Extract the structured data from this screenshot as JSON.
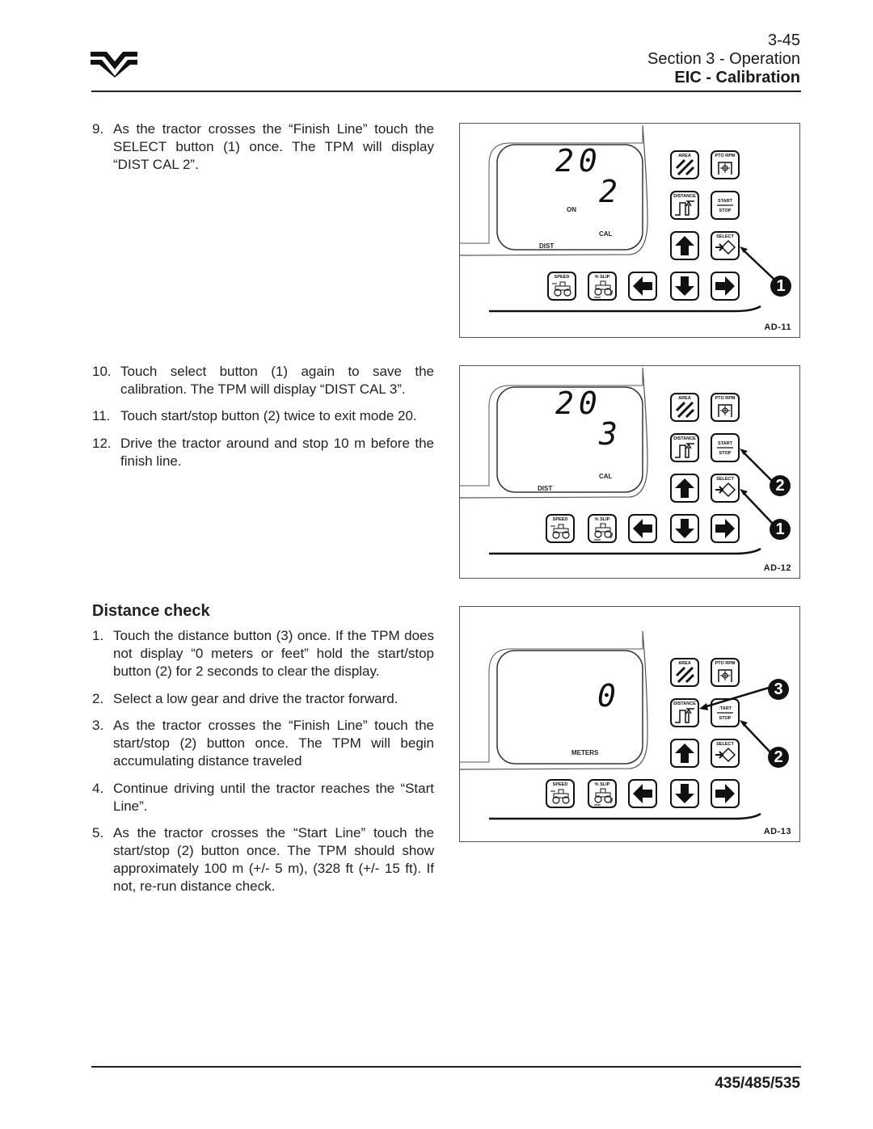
{
  "header": {
    "page_number": "3-45",
    "section": "Section 3 - Operation",
    "title": "EIC - Calibration"
  },
  "footer": {
    "model": "435/485/535"
  },
  "steps_top": [
    {
      "num": "9.",
      "text": "As the tractor crosses the “Finish Line” touch the SELECT button (1) once. The TPM will display “DIST CAL 2”."
    },
    {
      "num": "10.",
      "text": "Touch select button (1) again to save the calibration. The TPM will display “DIST CAL 3”."
    },
    {
      "num": "11.",
      "text": "Touch start/stop button (2) twice to exit mode 20."
    },
    {
      "num": "12.",
      "text": "Drive the tractor around and stop 10 m before the finish line."
    }
  ],
  "distance_check": {
    "heading": "Distance check",
    "steps": [
      {
        "num": "1.",
        "text": "Touch the distance button (3) once. If the TPM does not display “0 meters or feet” hold the start/stop button (2) for 2 seconds to clear the display."
      },
      {
        "num": "2.",
        "text": "Select a low gear and drive the tractor forward."
      },
      {
        "num": "3.",
        "text": "As the tractor crosses the “Finish Line” touch the start/stop (2) button once. The TPM will begin accumulating distance traveled"
      },
      {
        "num": "4.",
        "text": "Continue driving until the tractor reaches the “Start Line”."
      },
      {
        "num": "5.",
        "text": "As the tractor crosses the “Start Line” touch the start/stop (2) button once. The TPM should show approximately 100 m (+/- 5 m), (328 ft (+/- 15 ft). If not, re-run distance check."
      }
    ]
  },
  "keys": {
    "area": "AREA",
    "pto_rpm": "PTO RPM",
    "distance": "DISTANCE",
    "start": "START",
    "start_cut": ":TART",
    "stop": "STOP",
    "select": "SELECT",
    "speed": "SPEED",
    "slip": "% SLIP"
  },
  "figures": [
    {
      "id": "AD-11",
      "mode": "20",
      "value": "2",
      "on": "ON",
      "cal": "CAL",
      "dist": "DIST",
      "callouts": [
        "1"
      ]
    },
    {
      "id": "AD-12",
      "mode": "20",
      "value": "3",
      "cal": "CAL",
      "dist": "DIST",
      "callouts": [
        "2",
        "1"
      ]
    },
    {
      "id": "AD-13",
      "value": "0",
      "unit": "METERS",
      "callouts": [
        "3",
        "2"
      ]
    }
  ]
}
